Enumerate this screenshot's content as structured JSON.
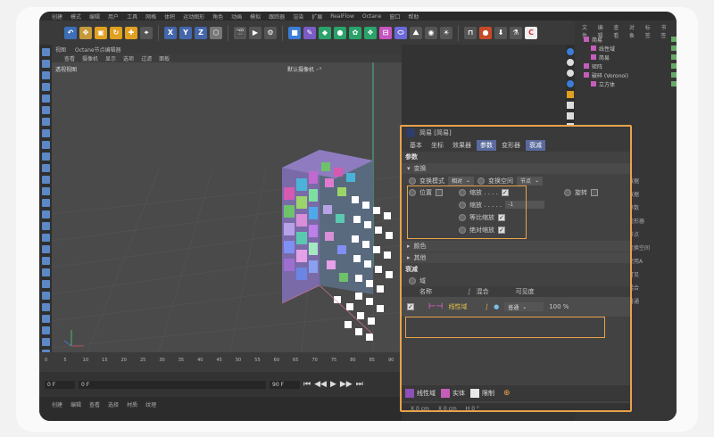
{
  "menubar": [
    "创建",
    "模式",
    "编辑",
    "用户",
    "工具",
    "网格",
    "体积",
    "运动图形",
    "角色",
    "动画",
    "模拟",
    "跟踪器",
    "渲染",
    "扩展",
    "RealFlow",
    "Octane",
    "窗口",
    "帮助"
  ],
  "viewport": {
    "header": "视图",
    "tab_label": "Octane节点编辑器",
    "menu": [
      "查看",
      "摄像机",
      "显示",
      "选项",
      "过滤",
      "面板"
    ],
    "view_name": "透视视图",
    "camera_name": "默认摄像机 ◦°"
  },
  "timeline": {
    "ticks": [
      "0",
      "5",
      "10",
      "15",
      "20",
      "25",
      "30",
      "35",
      "40",
      "45",
      "50",
      "55",
      "60",
      "65",
      "70",
      "75",
      "80",
      "85",
      "90"
    ],
    "start_field": "0 F",
    "current_field": "0 F",
    "end_field": "90 F"
  },
  "bottom_menu": [
    "创建",
    "编辑",
    "查看",
    "选择",
    "材质",
    "纹理"
  ],
  "object_manager": {
    "tabs": [
      "文件",
      "编辑",
      "查看",
      "对象",
      "标签",
      "书签"
    ],
    "items": [
      {
        "name": "简易",
        "indent": 0
      },
      {
        "name": "线性域",
        "indent": 1
      },
      {
        "name": "简易",
        "indent": 1
      },
      {
        "name": "矩阵",
        "indent": 0
      },
      {
        "name": "破碎 (Voronoi)",
        "indent": 0
      },
      {
        "name": "立方体",
        "indent": 1
      }
    ]
  },
  "right_partial": [
    "数据",
    "数据",
    "参数",
    "变形器",
    "节点",
    "变换空间",
    "使用A",
    "可见",
    "混合",
    "普通"
  ],
  "attributes": {
    "title": "简易 [简易]",
    "tabs": [
      {
        "label": "基本",
        "active": false
      },
      {
        "label": "坐标",
        "active": false
      },
      {
        "label": "效果器",
        "active": false
      },
      {
        "label": "参数",
        "active": true
      },
      {
        "label": "变形器",
        "active": false
      },
      {
        "label": "衰减",
        "active": true
      }
    ],
    "section_params": "参数",
    "group_transform": "变换",
    "transform_mode_label": "变换模式",
    "transform_mode_value": "相对",
    "transform_space_label": "变换空间",
    "transform_space_value": "节点",
    "position_label": "位置",
    "position_checked": false,
    "scale_label": "缩放 . . . .",
    "scale_checked": true,
    "scale_value_label": "缩放 . . . . .",
    "scale_value": "-1",
    "uniform_scale_label": "等比缩放",
    "uniform_scale_checked": true,
    "absolute_scale_label": "绝对缩放",
    "absolute_scale_checked": true,
    "rotation_label": "旋转",
    "rotation_checked": false,
    "group_color": "颜色",
    "group_other": "其他",
    "section_falloff": "衰减",
    "field_label": "域",
    "field_columns": {
      "name": "名称",
      "blend": "混合",
      "visibility": "可见度"
    },
    "field_row": {
      "name": "线性域",
      "blend": "普通",
      "visibility": "100 %"
    },
    "bottom_tools": [
      {
        "label": "线性域",
        "color": "#8e4fb8"
      },
      {
        "label": "实体",
        "color": "#c55dbb"
      },
      {
        "label": "限制",
        "color": "#e8e8e8"
      }
    ],
    "footer": [
      "X  0 cm",
      "X  0 cm",
      "H  0 °"
    ]
  },
  "colors": {
    "highlight": "#e8a24a",
    "active_tab": "#5a6a9e"
  }
}
